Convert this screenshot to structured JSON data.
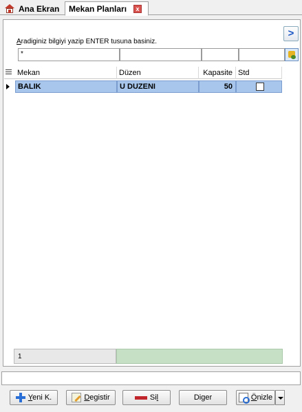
{
  "tabs": [
    {
      "label": "Ana Ekran",
      "icon": "home-icon"
    },
    {
      "label": "Mekan Planları",
      "icon": "close-icon",
      "close_symbol": "x"
    }
  ],
  "search": {
    "hint_underlined": "A",
    "hint_rest": "radiginiz bilgiyi yazip ENTER tusuna basiniz.",
    "filter_values": [
      "*",
      "",
      "",
      ""
    ],
    "nav_icon": "chevron-right-icon",
    "nav_symbol": ">",
    "filter_icon": "filter-icon"
  },
  "grid": {
    "columns": [
      "Mekan",
      "Düzen",
      "Kapasite",
      "Std"
    ],
    "rows": [
      {
        "mekan": "BALIK",
        "duzen": "U DUZENI",
        "kapasite": "50",
        "std": false
      }
    ],
    "selected_row_color": "#a8c6ec",
    "row_count": "1"
  },
  "buttons": {
    "new": {
      "u": "Y",
      "rest": "eni K.",
      "icon": "plus-icon"
    },
    "edit": {
      "u": "D",
      "rest": "egistir",
      "icon": "pencil-icon"
    },
    "delete": {
      "before": "Si",
      "u": "l",
      "icon": "minus-icon"
    },
    "other": {
      "label": "Diger"
    },
    "preview": {
      "u": "Ö",
      "rest": "nizle",
      "icon": "preview-icon"
    }
  },
  "colors": {
    "footer_green": "#c6e0c6",
    "close_red": "#d9534f"
  }
}
